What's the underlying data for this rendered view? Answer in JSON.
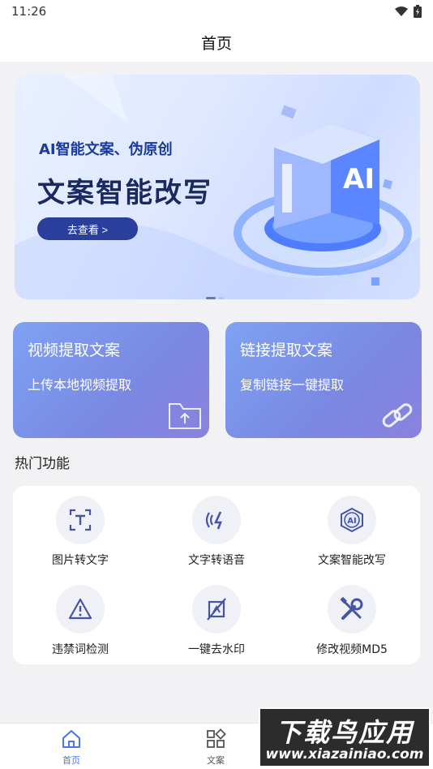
{
  "status": {
    "time": "11:26"
  },
  "header": {
    "title": "首页"
  },
  "banner": {
    "tagline": "AI智能文案、伪原创",
    "headline": "文案智能改写",
    "cta_label": "去查看 >",
    "art_badge": "AI"
  },
  "cards": [
    {
      "title": "视频提取文案",
      "subtitle": "上传本地视频提取",
      "icon": "upload-folder-icon"
    },
    {
      "title": "链接提取文案",
      "subtitle": "复制链接一键提取",
      "icon": "link-icon"
    }
  ],
  "hot": {
    "title": "热门功能",
    "items": [
      {
        "label": "图片转文字",
        "icon": "image-text-scan-icon"
      },
      {
        "label": "文字转语音",
        "icon": "voice-icon"
      },
      {
        "label": "文案智能改写",
        "icon": "ai-icon",
        "badge": "AI"
      },
      {
        "label": "违禁词检测",
        "icon": "warning-icon"
      },
      {
        "label": "一键去水印",
        "icon": "remove-watermark-icon"
      },
      {
        "label": "修改视频MD5",
        "icon": "tools-icon"
      }
    ]
  },
  "tabs": [
    {
      "label": "首页",
      "icon": "home-icon",
      "active": true
    },
    {
      "label": "文案",
      "icon": "grid-icon",
      "active": false
    }
  ],
  "watermark": {
    "big": "下载鸟应用",
    "small": "www.xiazainiao.com"
  },
  "colors": {
    "accent": "#4a74f0",
    "card_gradient_start": "#7ea2f2",
    "card_gradient_end": "#8a82de"
  }
}
